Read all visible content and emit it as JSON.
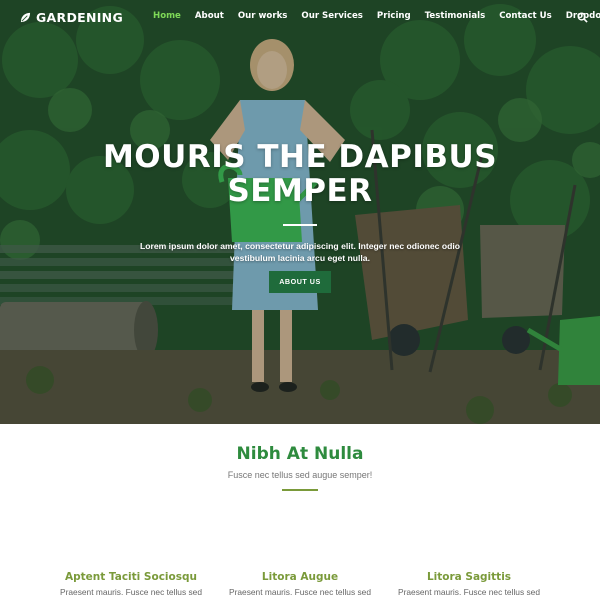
{
  "brand": {
    "name": "GARDENING",
    "icon": "leaf-icon"
  },
  "nav": {
    "items": [
      {
        "label": "Home",
        "active": true
      },
      {
        "label": "About",
        "active": false
      },
      {
        "label": "Our works",
        "active": false
      },
      {
        "label": "Our Services",
        "active": false
      },
      {
        "label": "Pricing",
        "active": false
      },
      {
        "label": "Testimonials",
        "active": false
      },
      {
        "label": "Contact Us",
        "active": false
      },
      {
        "label": "Dropdown",
        "active": false
      }
    ],
    "search_icon": "search-icon",
    "dropdown_icon": "chevron-down-icon"
  },
  "hero": {
    "title_line1": "MOURIS THE DAPIBUS",
    "title_line2": "SEMPER",
    "description_line1": "Lorem ipsum dolor amet, consectetur adipiscing elit. Integer nec odionec odio",
    "description_line2": "vestibulum lacinia arcu eget nulla.",
    "button_label": "ABOUT US"
  },
  "section": {
    "title": "Nibh At Nulla",
    "subtitle": "Fusce nec tellus sed augue semper!"
  },
  "features": [
    {
      "title": "Aptent Taciti Sociosqu",
      "text": "Praesent mauris. Fusce nec tellus sed"
    },
    {
      "title": "Litora Augue",
      "text": "Praesent mauris. Fusce nec tellus sed"
    },
    {
      "title": "Litora Sagittis",
      "text": "Praesent mauris. Fusce nec tellus sed"
    }
  ],
  "colors": {
    "accent_green": "#7ed957",
    "button_green": "#1f6b3b",
    "heading_green": "#2e8b3e",
    "olive": "#7a9a3a"
  }
}
